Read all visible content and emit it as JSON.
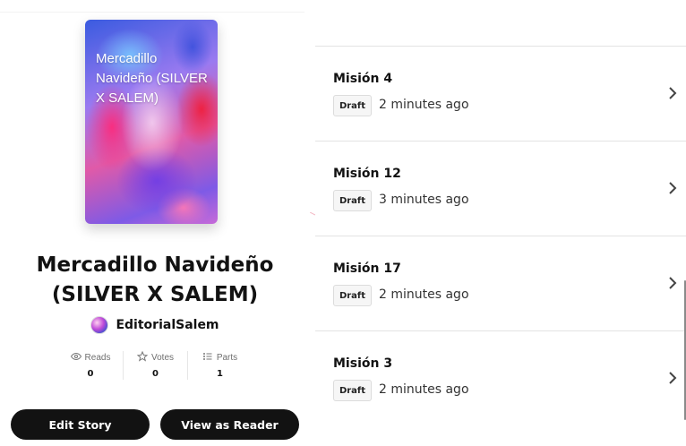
{
  "story": {
    "cover_title": "Mercadillo Navideño (SILVER X SALEM)",
    "title": "Mercadillo Navideño (SILVER X SALEM)",
    "author": "EditorialSalem"
  },
  "stats": [
    {
      "icon": "eye-icon",
      "label": "Reads",
      "value": "0"
    },
    {
      "icon": "star-icon",
      "label": "Votes",
      "value": "0"
    },
    {
      "icon": "list-icon",
      "label": "Parts",
      "value": "1"
    }
  ],
  "actions": {
    "edit_label": "Edit Story",
    "view_label": "View as Reader"
  },
  "parts": [
    {
      "title": "Misión 4",
      "status": "Draft",
      "time": "2 minutes ago"
    },
    {
      "title": "Misión 12",
      "status": "Draft",
      "time": "3 minutes ago"
    },
    {
      "title": "Misión 17",
      "status": "Draft",
      "time": "2 minutes ago"
    },
    {
      "title": "Misión 3",
      "status": "Draft",
      "time": "2 minutes ago"
    }
  ],
  "colors": {
    "button_bg": "#121212",
    "text": "#121212",
    "divider": "#e3e3e3",
    "badge_bg": "#f6f6f6"
  }
}
